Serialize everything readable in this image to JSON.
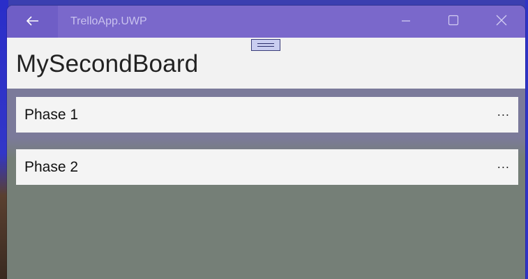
{
  "window": {
    "app_title": "TrelloApp.UWP",
    "back_icon": "arrow-left-icon",
    "minimize_icon": "minimize-icon",
    "maximize_icon": "maximize-icon",
    "close_icon": "close-icon",
    "titlebar_color": "#7a68cb"
  },
  "board": {
    "title": "MySecondBoard"
  },
  "lists": [
    {
      "name": "Phase 1",
      "menu_label": "..."
    },
    {
      "name": "Phase 2",
      "menu_label": "..."
    }
  ],
  "colors": {
    "background": "#757f77",
    "card": "#f4f4f4",
    "header": "#f2f2f2"
  }
}
